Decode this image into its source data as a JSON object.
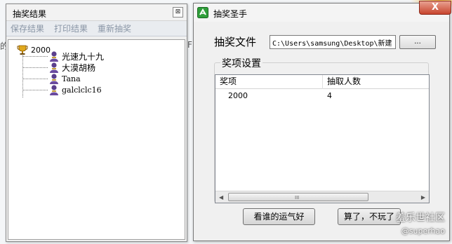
{
  "background": {
    "fragment_left": "的",
    "fragment_mid": "F"
  },
  "results_window": {
    "title": "抽奖结果",
    "close_glyph": "⊠",
    "toolbar": {
      "save_label": "保存结果",
      "print_label": "打印结果",
      "redraw_label": "重新抽奖"
    },
    "tree": {
      "root_label": "2000",
      "items": [
        "光速九十九",
        "大漠胡杨",
        "Tana",
        "galclclc16"
      ]
    }
  },
  "main_window": {
    "title": "抽奖圣手",
    "close_glyph": "X",
    "file_label": "抽奖文件",
    "file_path": "C:\\Users\\samsung\\Desktop\\新建",
    "browse_label": "...",
    "group_title": "奖项设置",
    "table": {
      "columns": [
        "奖项",
        "抽取人数"
      ],
      "rows": [
        [
          "2000",
          "4"
        ]
      ]
    },
    "scroll_grip": "III",
    "luck_button": "看谁的运气好",
    "quit_button": "算了，不玩了"
  },
  "watermark": {
    "main": "羞乐世社区",
    "sub": "@superhao"
  },
  "colors": {
    "toolbar_text": "#8a96a6",
    "close_red": "#c7452e"
  }
}
